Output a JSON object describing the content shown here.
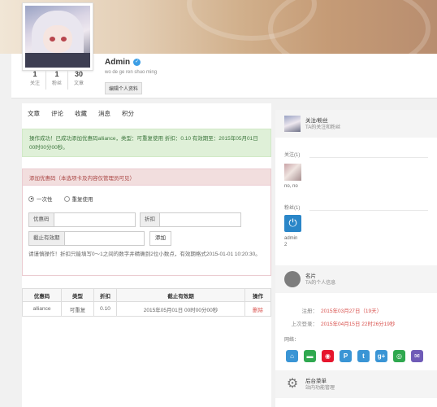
{
  "profile": {
    "username": "Admin",
    "motto": "wo de ge ren shuo ming",
    "edit_label": "编辑个人资料",
    "stats": [
      {
        "num": "1",
        "label": "关注"
      },
      {
        "num": "1",
        "label": "粉丝"
      },
      {
        "num": "30",
        "label": "文章"
      }
    ]
  },
  "tabs": [
    "文章",
    "评论",
    "收藏",
    "消息",
    "积分"
  ],
  "alert_success": "操作成功！已成功添加优惠码alliance，类型：可重复使用 折扣：0.10 有效期至：2015年05月01日 00时00分00秒。",
  "coupon_form": {
    "panel_title": "添加优惠码（本选项卡及内容仅管理员可见）",
    "radio_once": "一次性",
    "radio_repeat": "重复使用",
    "code_label": "优惠码",
    "discount_label": "折扣",
    "expiry_label": "截止有效期",
    "add_label": "添加",
    "help_text": "请谨慎操作！折扣只能填写0～1之间的数字并精确到2位小数点，有效期格式2015-01-01 10:20:30。"
  },
  "coupon_table": {
    "headers": [
      "优惠码",
      "类型",
      "折扣",
      "截止有效期",
      "操作"
    ],
    "rows": [
      {
        "code": "alliance",
        "type": "可重复",
        "discount": "0.10",
        "expiry": "2015年05月01日 00时00分00秒",
        "action": "删除"
      }
    ]
  },
  "sidebar": {
    "follow_title": "关注/粉丝",
    "follow_subtitle": "TA的关注和粉丝",
    "following_label": "关注(1)",
    "following_name": "no, no",
    "followers_label": "粉丝(1)",
    "followers_name": "admin",
    "followers_count": "2",
    "card_title": "名片",
    "card_subtitle": "TA的个人信息",
    "registered_key": "注册：",
    "registered_val": "2015年03月27日（19天）",
    "last_login_key": "上次登录：",
    "last_login_val": "2015年04月15日 22时26分19秒",
    "website_key": "网络：",
    "menu_title": "后台菜单",
    "menu_subtitle": "站内功能管理"
  },
  "colors": {
    "success_bg": "#dff0d8",
    "danger_bg": "#f2dede",
    "danger_text": "#a94442",
    "link_red": "#d9534f",
    "verified_blue": "#3c9ee5"
  },
  "socials": [
    {
      "icon": "home-icon",
      "color": "#3a95d5",
      "glyph": "⌂"
    },
    {
      "icon": "wechat-moments-icon",
      "color": "#2fa84f",
      "glyph": "▬"
    },
    {
      "icon": "weibo-icon",
      "color": "#e6162d",
      "glyph": "◉"
    },
    {
      "icon": "pinterest-icon",
      "color": "#3a95d5",
      "glyph": "P"
    },
    {
      "icon": "twitter-icon",
      "color": "#3a95d5",
      "glyph": "t"
    },
    {
      "icon": "google-plus-icon",
      "color": "#3a95d5",
      "glyph": "g+"
    },
    {
      "icon": "wechat-icon",
      "color": "#2fa84f",
      "glyph": "◎"
    },
    {
      "icon": "email-icon",
      "color": "#6f5bb7",
      "glyph": "✉"
    }
  ]
}
